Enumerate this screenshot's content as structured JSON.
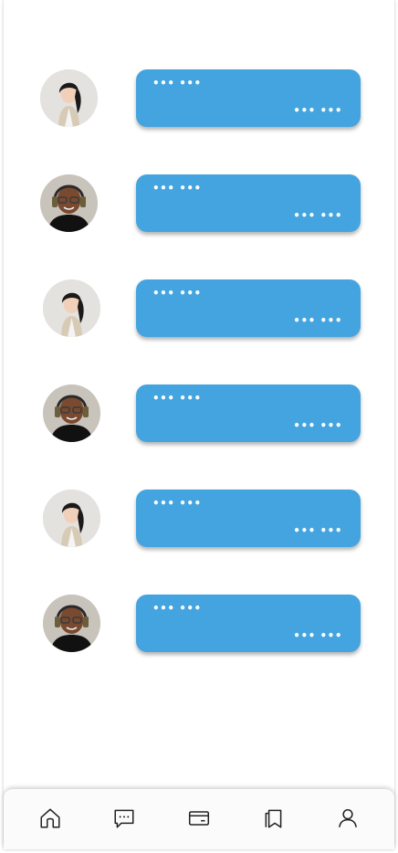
{
  "feed": {
    "items": [
      {
        "avatar": "woman-avatar",
        "title": "••• •••",
        "meta": "••• •••"
      },
      {
        "avatar": "man-headphones-avatar",
        "title": "••• •••",
        "meta": "••• •••"
      },
      {
        "avatar": "woman-avatar",
        "title": "••• •••",
        "meta": "••• •••"
      },
      {
        "avatar": "man-headphones-avatar",
        "title": "••• •••",
        "meta": "••• •••"
      },
      {
        "avatar": "woman-avatar",
        "title": "••• •••",
        "meta": "••• •••"
      },
      {
        "avatar": "man-headphones-avatar",
        "title": "••• •••",
        "meta": "••• •••"
      }
    ]
  },
  "colors": {
    "bubble": "#44a4e0",
    "background": "#ffffff",
    "navbar": "#fbfbfb",
    "icon": "#222222"
  },
  "navbar": {
    "items": [
      {
        "icon": "home-icon"
      },
      {
        "icon": "chat-icon"
      },
      {
        "icon": "card-icon"
      },
      {
        "icon": "bookmarks-icon"
      },
      {
        "icon": "profile-icon"
      }
    ]
  }
}
